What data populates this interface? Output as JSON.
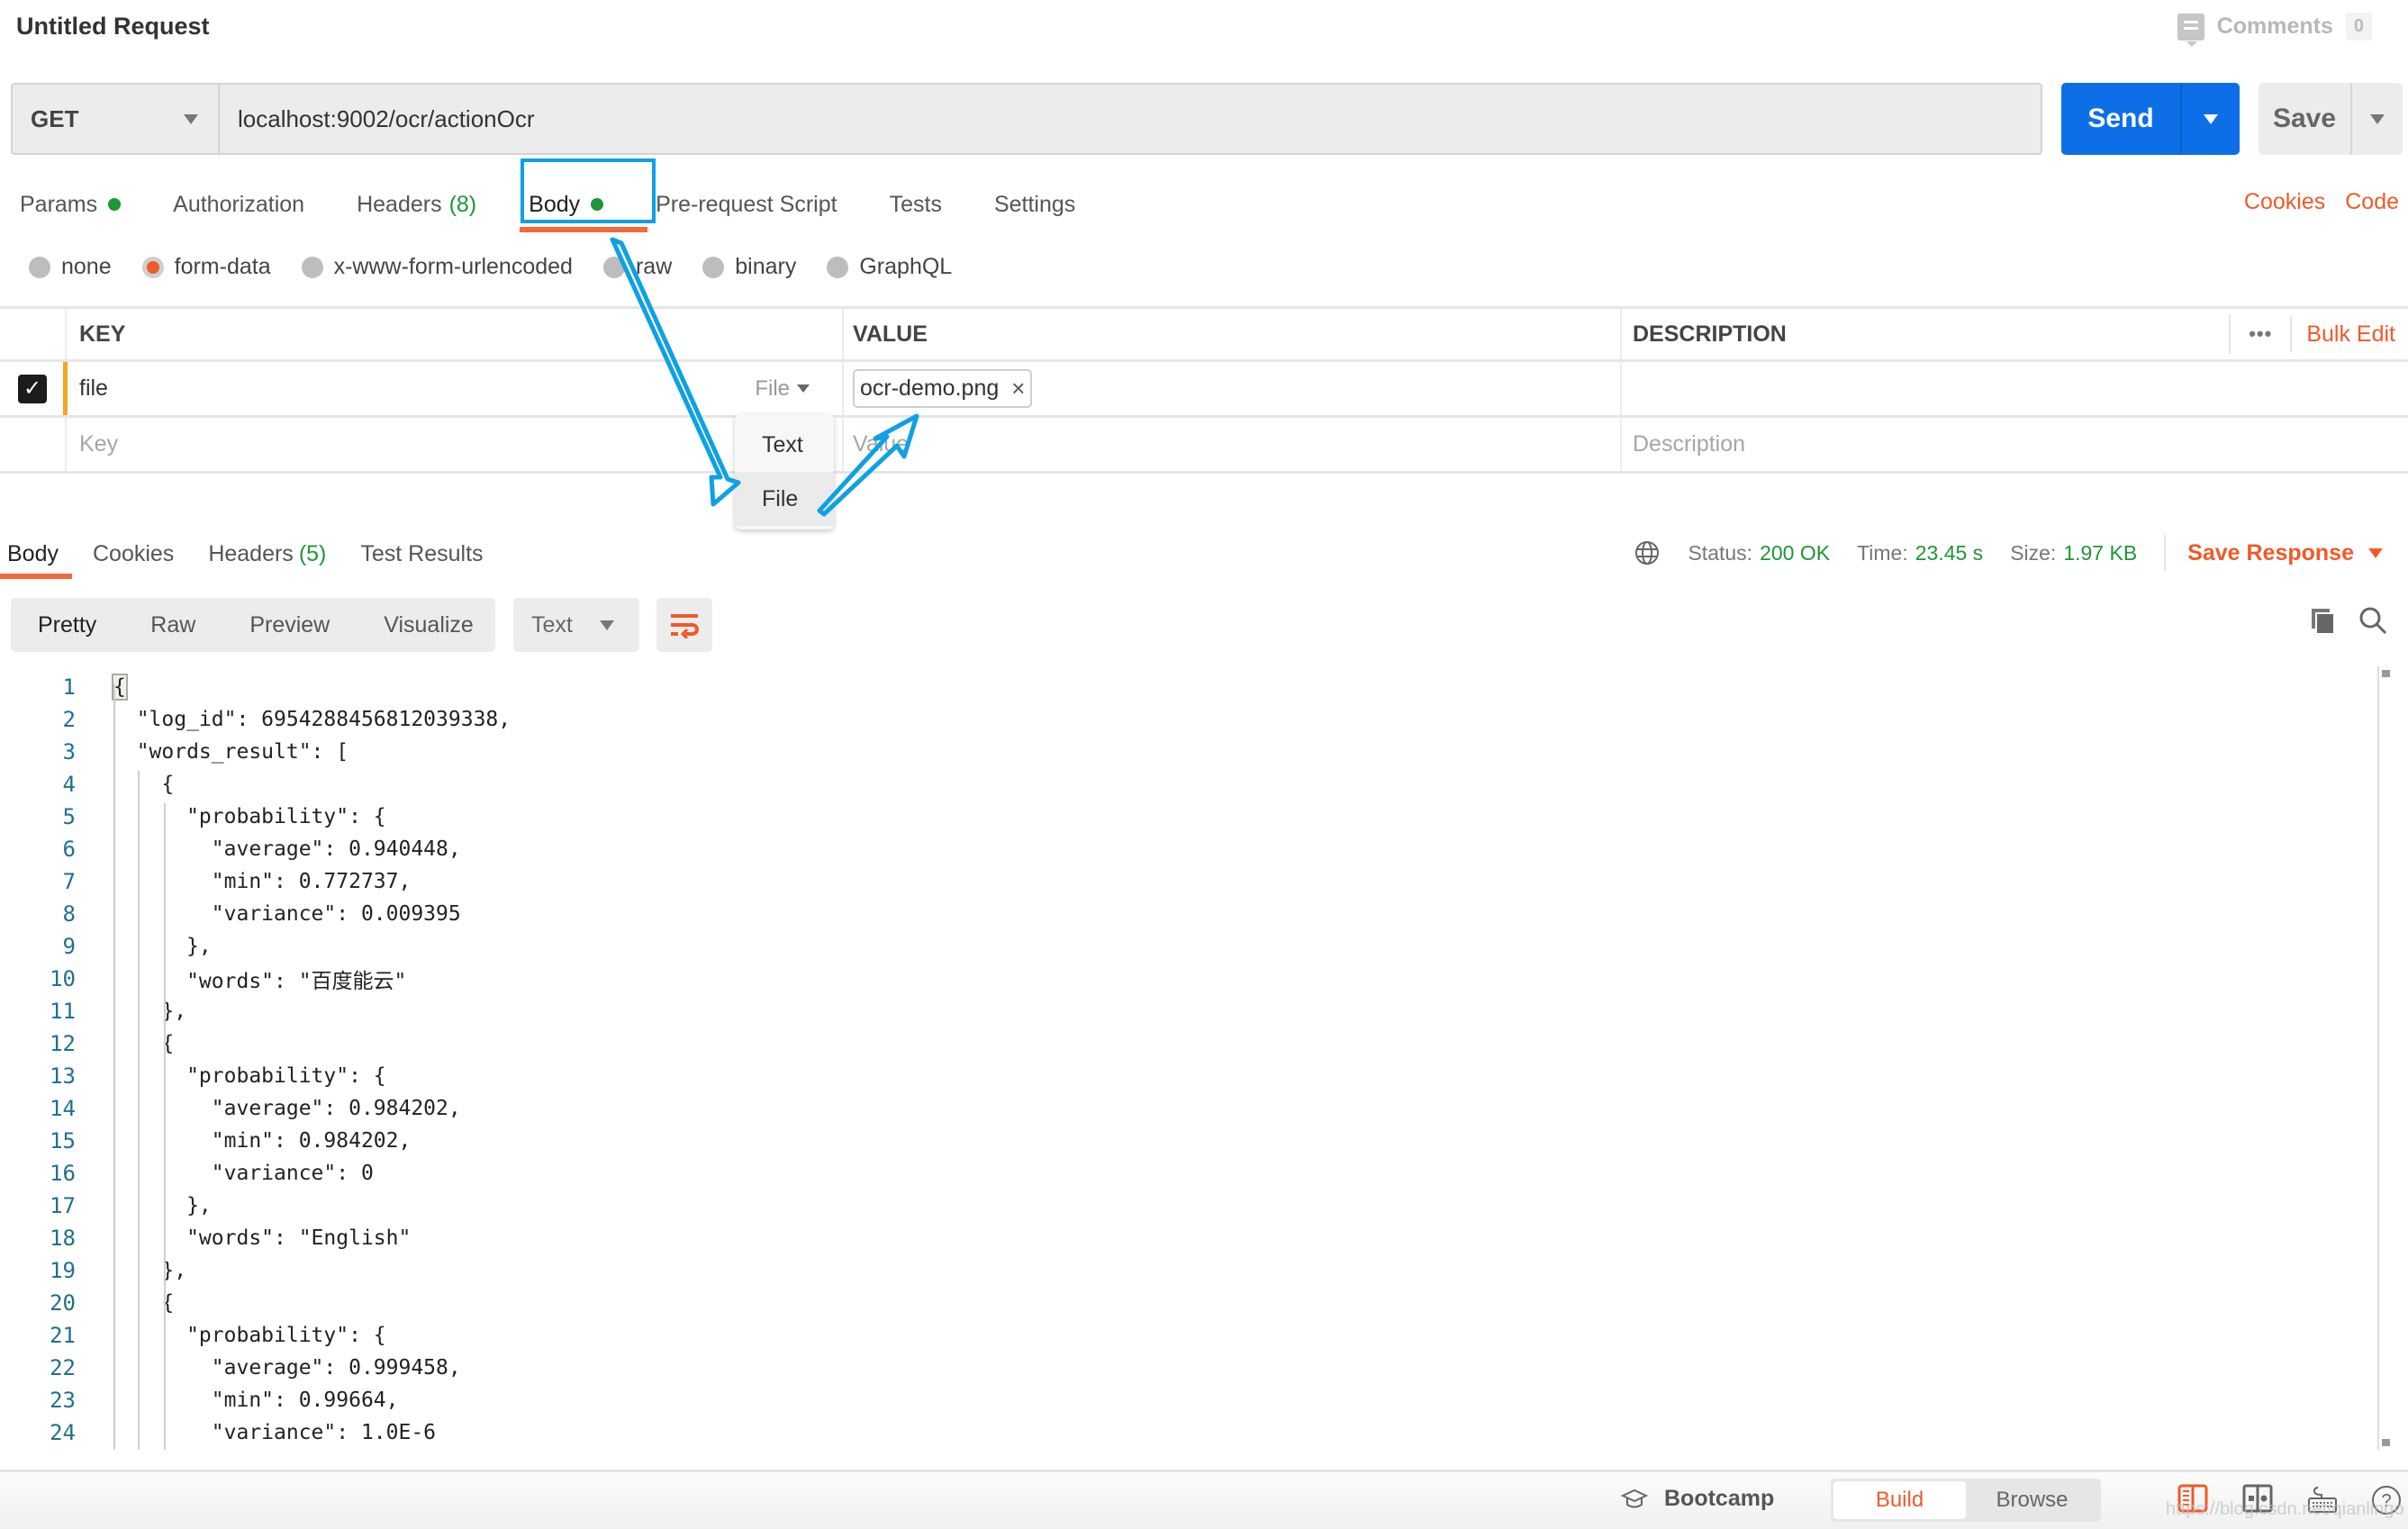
{
  "request": {
    "title": "Untitled Request",
    "comments_label": "Comments",
    "comments_count": "0",
    "method": "GET",
    "url": "localhost:9002/ocr/actionOcr",
    "send_label": "Send",
    "save_label": "Save"
  },
  "request_tabs": [
    {
      "label": "Params",
      "dot": true
    },
    {
      "label": "Authorization"
    },
    {
      "label": "Headers",
      "count": "(8)"
    },
    {
      "label": "Body",
      "dot": true,
      "active": true
    },
    {
      "label": "Pre-request Script"
    },
    {
      "label": "Tests"
    },
    {
      "label": "Settings"
    }
  ],
  "request_links": {
    "cookies": "Cookies",
    "code": "Code"
  },
  "body_types": [
    {
      "label": "none"
    },
    {
      "label": "form-data",
      "selected": true
    },
    {
      "label": "x-www-form-urlencoded"
    },
    {
      "label": "raw"
    },
    {
      "label": "binary"
    },
    {
      "label": "GraphQL"
    }
  ],
  "params_table": {
    "headers": {
      "key": "KEY",
      "value": "VALUE",
      "description": "DESCRIPTION"
    },
    "more_label": "•••",
    "bulk_edit_label": "Bulk Edit",
    "rows": [
      {
        "checked": true,
        "key": "file",
        "type": "File",
        "value": "ocr-demo.png",
        "remove_icon": "×"
      }
    ],
    "placeholders": {
      "key": "Key",
      "value": "Value",
      "description": "Description"
    },
    "type_menu": [
      "Text",
      "File"
    ],
    "type_menu_highlighted": "File"
  },
  "response": {
    "tabs": [
      {
        "label": "Body",
        "active": true
      },
      {
        "label": "Cookies"
      },
      {
        "label": "Headers",
        "count": "(5)"
      },
      {
        "label": "Test Results"
      }
    ],
    "status_label": "Status:",
    "status_value": "200 OK",
    "time_label": "Time:",
    "time_value": "23.45 s",
    "size_label": "Size:",
    "size_value": "1.97 KB",
    "save_response_label": "Save Response",
    "view_modes": [
      "Pretty",
      "Raw",
      "Preview",
      "Visualize"
    ],
    "active_view_mode": "Pretty",
    "format": "Text",
    "code_lines": [
      "{",
      "  \"log_id\": 6954288456812039338,",
      "  \"words_result\": [",
      "    {",
      "      \"probability\": {",
      "        \"average\": 0.940448,",
      "        \"min\": 0.772737,",
      "        \"variance\": 0.009395",
      "      },",
      "      \"words\": \"百度能云\"",
      "    },",
      "    {",
      "      \"probability\": {",
      "        \"average\": 0.984202,",
      "        \"min\": 0.984202,",
      "        \"variance\": 0",
      "      },",
      "      \"words\": \"English\"",
      "    },",
      "    {",
      "      \"probability\": {",
      "        \"average\": 0.999458,",
      "        \"min\": 0.99664,",
      "        \"variance\": 1.0E-6"
    ]
  },
  "footer": {
    "bootcamp_label": "Bootcamp",
    "build_label": "Build",
    "browse_label": "Browse",
    "active_mode": "Build",
    "watermark": "https://blog.csdn.net/qianlingo"
  },
  "colors": {
    "accent": "#f05a28",
    "primary": "#0c6fe8",
    "success": "#1e9636",
    "annotation": "#0ea1e4"
  }
}
